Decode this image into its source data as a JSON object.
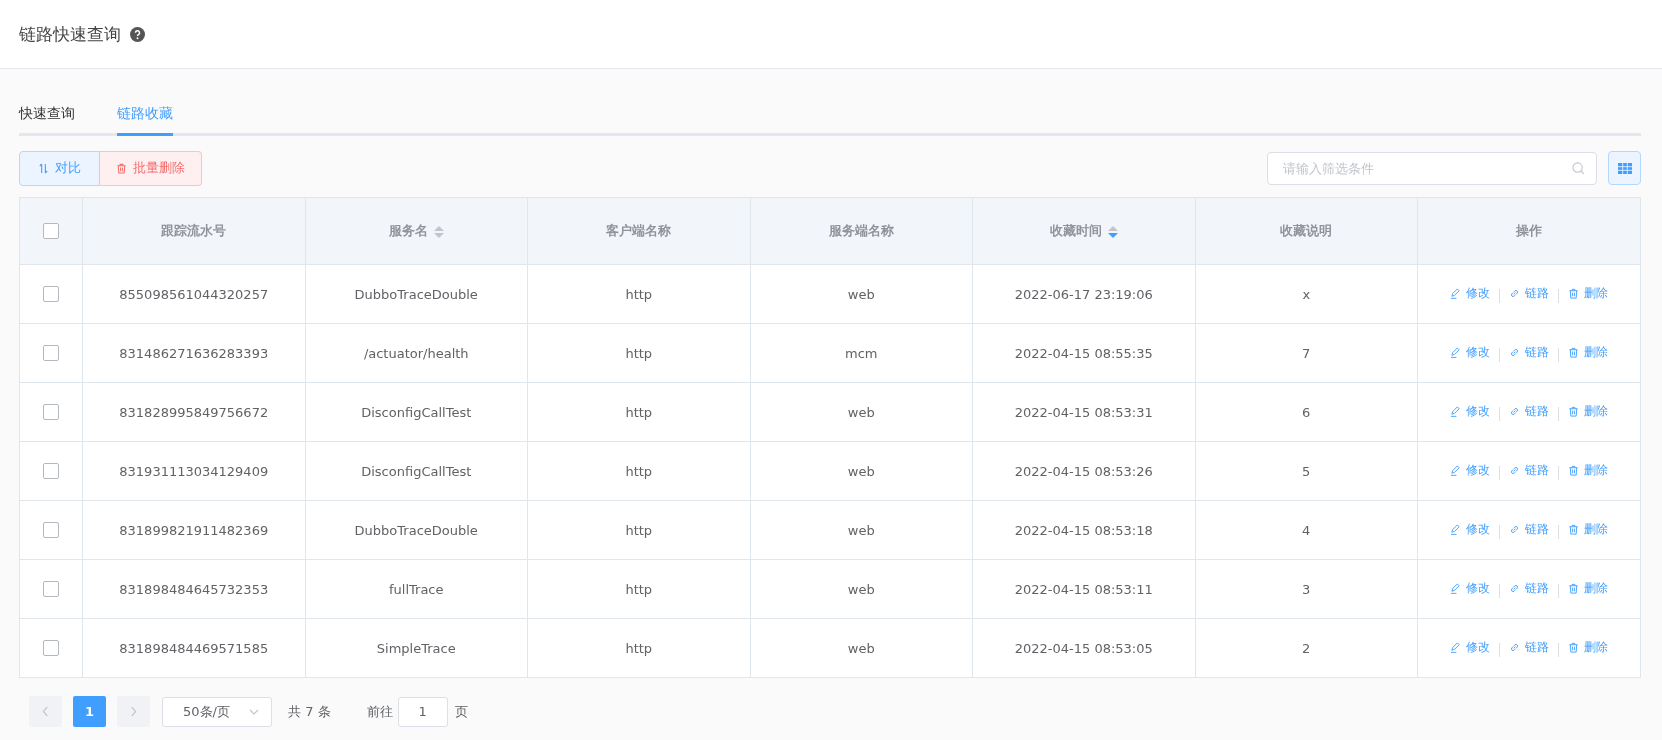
{
  "page_title": "链路快速查询",
  "tabs": [
    {
      "label": "快速查询",
      "selected": false
    },
    {
      "label": "链路收藏",
      "selected": true
    }
  ],
  "toolbar": {
    "buttons": [
      {
        "label": "对比",
        "kind": "compare"
      },
      {
        "label": "批量删除",
        "kind": "delete"
      }
    ],
    "search": {
      "placeholder": "请输入筛选条件"
    }
  },
  "table": {
    "select_all_checked": false,
    "columns": [
      {
        "label": "跟踪流水号"
      },
      {
        "label": "服务名",
        "sortable": true,
        "sorted_desc": false
      },
      {
        "label": "客户端名称"
      },
      {
        "label": "服务端名称"
      },
      {
        "label": "收藏时间",
        "sortable": true,
        "sorted_desc": true
      },
      {
        "label": "收藏说明"
      },
      {
        "label": "操作"
      }
    ],
    "rows": [
      {
        "checked": false,
        "cells": [
          "855098561044320257",
          "DubboTraceDouble",
          "http",
          "web",
          "2022-06-17 23:19:06",
          "x"
        ],
        "actions": [
          {
            "label": "修改",
            "kind": "edit"
          },
          {
            "label": "链路",
            "kind": "link"
          },
          {
            "label": "删除",
            "kind": "delete"
          }
        ]
      },
      {
        "checked": false,
        "cells": [
          "831486271636283393",
          "/actuator/health",
          "http",
          "mcm",
          "2022-04-15 08:55:35",
          "7"
        ],
        "actions": [
          {
            "label": "修改",
            "kind": "edit"
          },
          {
            "label": "链路",
            "kind": "link"
          },
          {
            "label": "删除",
            "kind": "delete"
          }
        ]
      },
      {
        "checked": false,
        "cells": [
          "831828995849756672",
          "DisconfigCallTest",
          "http",
          "web",
          "2022-04-15 08:53:31",
          "6"
        ],
        "actions": [
          {
            "label": "修改",
            "kind": "edit"
          },
          {
            "label": "链路",
            "kind": "link"
          },
          {
            "label": "删除",
            "kind": "delete"
          }
        ]
      },
      {
        "checked": false,
        "cells": [
          "831931113034129409",
          "DisconfigCallTest",
          "http",
          "web",
          "2022-04-15 08:53:26",
          "5"
        ],
        "actions": [
          {
            "label": "修改",
            "kind": "edit"
          },
          {
            "label": "链路",
            "kind": "link"
          },
          {
            "label": "删除",
            "kind": "delete"
          }
        ]
      },
      {
        "checked": false,
        "cells": [
          "831899821911482369",
          "DubboTraceDouble",
          "http",
          "web",
          "2022-04-15 08:53:18",
          "4"
        ],
        "actions": [
          {
            "label": "修改",
            "kind": "edit"
          },
          {
            "label": "链路",
            "kind": "link"
          },
          {
            "label": "删除",
            "kind": "delete"
          }
        ]
      },
      {
        "checked": false,
        "cells": [
          "831898484645732353",
          "fullTrace",
          "http",
          "web",
          "2022-04-15 08:53:11",
          "3"
        ],
        "actions": [
          {
            "label": "修改",
            "kind": "edit"
          },
          {
            "label": "链路",
            "kind": "link"
          },
          {
            "label": "删除",
            "kind": "delete"
          }
        ]
      },
      {
        "checked": false,
        "cells": [
          "831898484469571585",
          "SimpleTrace",
          "http",
          "web",
          "2022-04-15 08:53:05",
          "2"
        ],
        "actions": [
          {
            "label": "修改",
            "kind": "edit"
          },
          {
            "label": "链路",
            "kind": "link"
          },
          {
            "label": "删除",
            "kind": "delete"
          }
        ]
      }
    ]
  },
  "pagination": {
    "pages": [
      {
        "label": "1",
        "selected": true
      }
    ],
    "page_size": "50条/页",
    "total": "共 7 条",
    "goto_label": "前往",
    "goto_value": "1",
    "goto_suffix": "页"
  }
}
